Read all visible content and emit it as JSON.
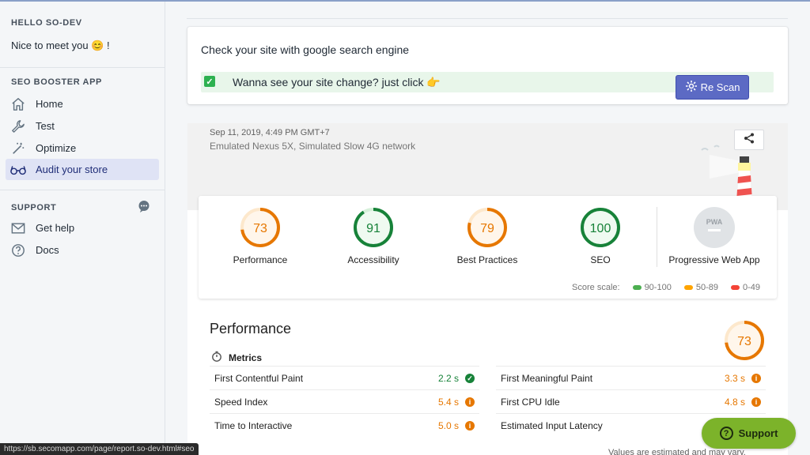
{
  "sidebar": {
    "hello_title": "HELLO SO-DEV",
    "greeting": "Nice to meet you 😊  !",
    "app_title": "SEO BOOSTER APP",
    "nav": [
      {
        "label": "Home",
        "icon": "home-icon"
      },
      {
        "label": "Test",
        "icon": "wrench-icon"
      },
      {
        "label": "Optimize",
        "icon": "magic-wand-icon"
      },
      {
        "label": "Audit your store",
        "icon": "glasses-icon",
        "active": true
      }
    ],
    "support_title": "SUPPORT",
    "support_items": [
      {
        "label": "Get help",
        "icon": "mail-icon"
      },
      {
        "label": "Docs",
        "icon": "question-circle-icon"
      }
    ]
  },
  "check_card": {
    "title": "Check your site with google search engine",
    "notice": "Wanna see your site change? just click 👉",
    "rescan_label": "Re Scan"
  },
  "report": {
    "date": "Sep 11, 2019, 4:49 PM GMT+7",
    "device": "Emulated Nexus 5X, Simulated Slow 4G network",
    "scores": [
      {
        "label": "Performance",
        "value": "73",
        "fraction": 0.73,
        "color": "#e67700"
      },
      {
        "label": "Accessibility",
        "value": "91",
        "fraction": 0.91,
        "color": "#178239"
      },
      {
        "label": "Best Practices",
        "value": "79",
        "fraction": 0.79,
        "color": "#e67700"
      },
      {
        "label": "SEO",
        "value": "100",
        "fraction": 1.0,
        "color": "#178239"
      }
    ],
    "pwa": {
      "label": "Progressive Web App",
      "badge": "PWA"
    },
    "scale": {
      "title": "Score scale:",
      "ranges": [
        {
          "label": "90-100",
          "color": "#4caf50"
        },
        {
          "label": "50-89",
          "color": "#ffa400"
        },
        {
          "label": "0-49",
          "color": "#f44336"
        }
      ]
    },
    "performance": {
      "title": "Performance",
      "score": "73",
      "fraction": 0.73,
      "metrics_title": "Metrics",
      "left_metrics": [
        {
          "label": "First Contentful Paint",
          "value": "2.2 s",
          "status": "pass"
        },
        {
          "label": "Speed Index",
          "value": "5.4 s",
          "status": "average"
        },
        {
          "label": "Time to Interactive",
          "value": "5.0 s",
          "status": "average"
        }
      ],
      "right_metrics": [
        {
          "label": "First Meaningful Paint",
          "value": "3.3 s",
          "status": "average"
        },
        {
          "label": "First CPU Idle",
          "value": "4.8 s",
          "status": "average"
        },
        {
          "label": "Estimated Input Latency",
          "value": "",
          "status": "none"
        }
      ],
      "footnote": "Values are estimated and may vary."
    }
  },
  "status_url": "https://sb.secomapp.com/page/report.so-dev.html#seo",
  "support_button": "Support",
  "colors": {
    "accent": "#5c6ac4",
    "pass": "#178239",
    "average": "#e67700",
    "support": "#7cb32a"
  }
}
